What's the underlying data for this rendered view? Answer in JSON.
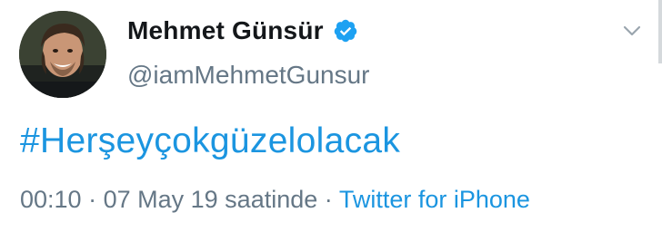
{
  "author": {
    "display_name": "Mehmet Günsür",
    "handle": "@iamMehmetGunsur",
    "avatar_icon": "avatar-photo",
    "verified_icon": "verified-badge-icon"
  },
  "tweet": {
    "text": "#Herşeyçokgüzelolacak",
    "time": "00:10",
    "date_text": "07 May 19 saatinde",
    "separator": "·",
    "source": "Twitter for iPhone"
  },
  "menu_icon": "chevron-down-icon",
  "colors": {
    "link": "#1b95e0",
    "name": "#14171a",
    "muted": "#657786",
    "verified": "#1da1f2"
  }
}
